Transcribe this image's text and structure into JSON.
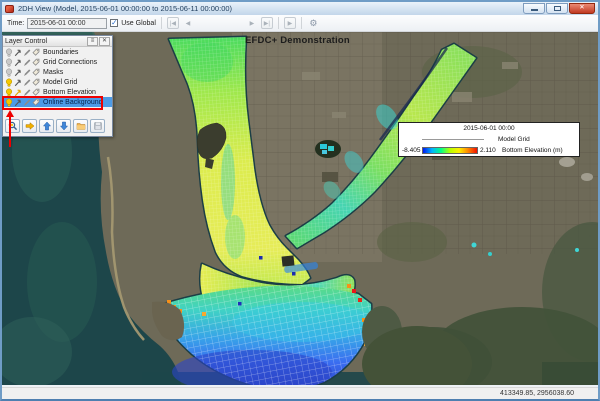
{
  "window": {
    "title": "2DH View (Model, 2015-06-01 00:00:00 to 2015-06-11 00:00:00)"
  },
  "toolbar": {
    "time_label": "Time:",
    "time_value": "2015-06-01 00:00",
    "use_global_label": "Use Global",
    "use_global_checked": true
  },
  "icons": {
    "check": "✓",
    "window_close": "✕",
    "menu": "≡",
    "panel_close": "✕",
    "first": "|◀",
    "prev": "◀",
    "next": "▶",
    "last": "▶|",
    "play": "▶",
    "gear": "⚙"
  },
  "map": {
    "title_overlay": "EFDC+ Demonstration"
  },
  "layer_control": {
    "title": "Layer Control",
    "items": [
      {
        "label": "Boundaries",
        "visible": false
      },
      {
        "label": "Grid Connections",
        "visible": false
      },
      {
        "label": "Masks",
        "visible": false
      },
      {
        "label": "Model Grid",
        "visible": true
      },
      {
        "label": "Bottom Elevation",
        "visible": true
      },
      {
        "label": "Online Background",
        "visible": true,
        "selected": true
      }
    ]
  },
  "legend": {
    "datetime": "2015-06-01 00:00",
    "model_grid_label": "Model Grid",
    "min_value": "-8.405",
    "max_value": "2.110",
    "bottom_elevation_label": "Bottom Elevation (m)",
    "colormap": [
      "#0018f0",
      "#00b4ff",
      "#00ff88",
      "#b8ff00",
      "#fff000",
      "#ff8800",
      "#f01000"
    ]
  },
  "status_bar": {
    "coordinates": "413349.85, 2956038.60"
  },
  "colors": {
    "selection_blue": "#4d9be6",
    "annotation_red": "#ee0000",
    "titlebar_blue": "#c2d6ea"
  }
}
